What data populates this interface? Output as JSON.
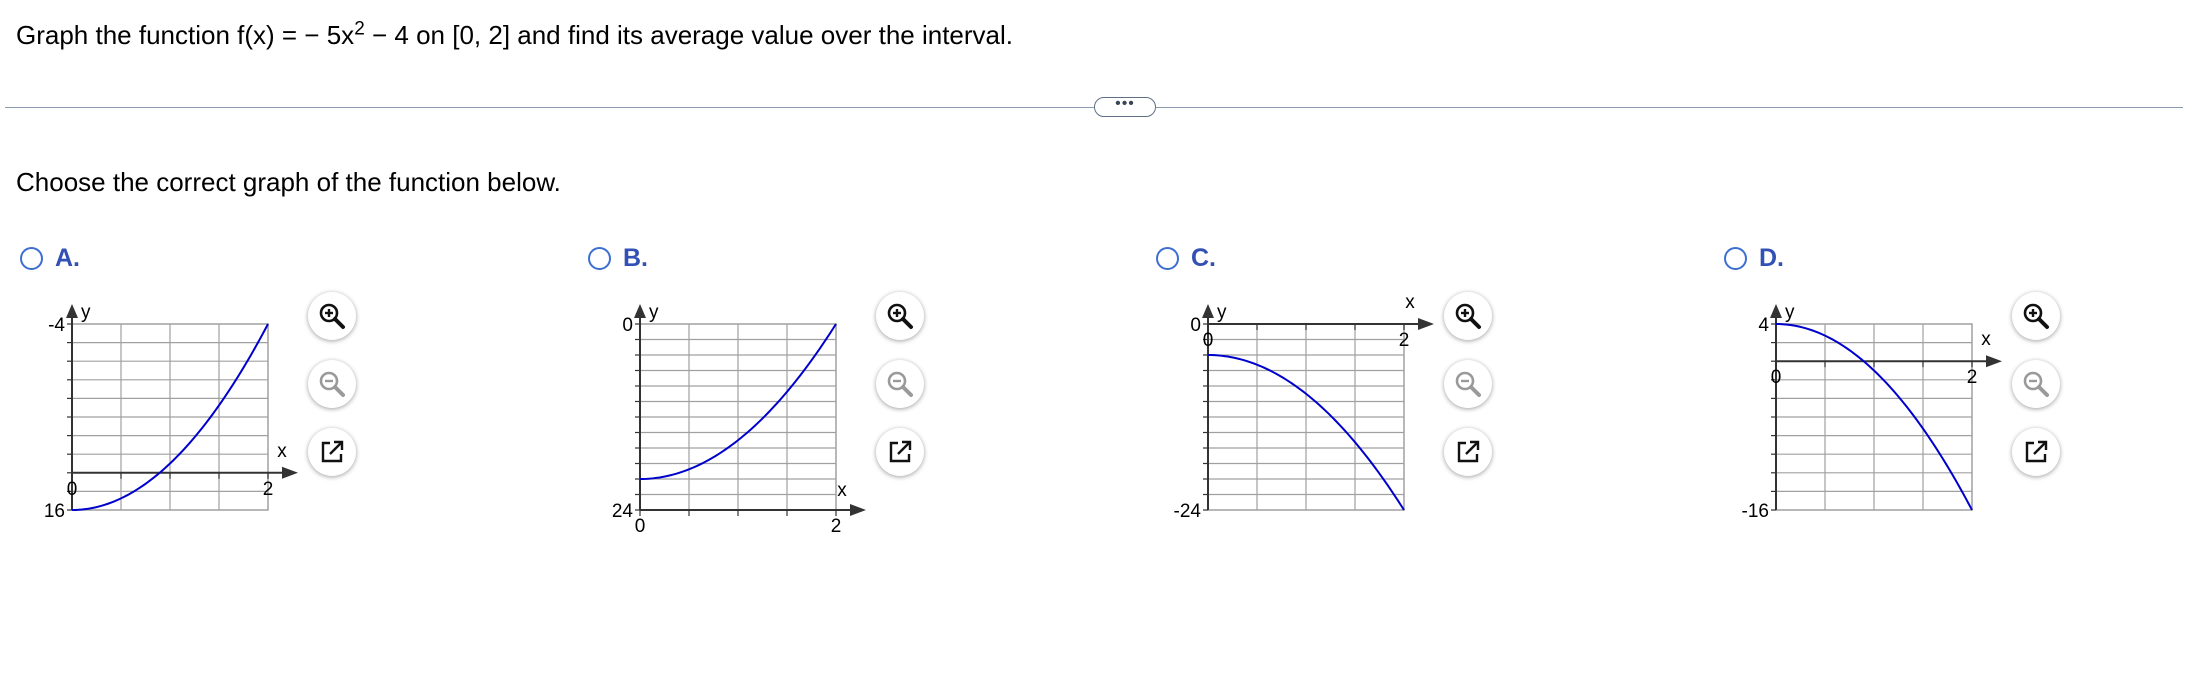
{
  "question": {
    "prefix": "Graph the function f(x) = − 5x",
    "exponent": "2",
    "suffix": " − 4 on [0, 2] and find its average value over the interval."
  },
  "more_button": {
    "label": "•••"
  },
  "instruction": "Choose the correct graph of the function below.",
  "options": [
    {
      "letter": "A.",
      "chart_data": {
        "type": "line",
        "xlabel": "x",
        "ylabel": "y",
        "xlim": [
          0,
          2
        ],
        "ylim": [
          -4,
          16
        ],
        "x_tick_labels": [
          "0",
          "2"
        ],
        "y_tick_labels": [
          "-4",
          "16"
        ],
        "series": [
          {
            "function": "5x^2 - 4",
            "x": [
              0,
              0.5,
              1,
              1.5,
              2
            ],
            "y": [
              -4,
              -2.75,
              1,
              7.25,
              16
            ]
          }
        ]
      }
    },
    {
      "letter": "B.",
      "chart_data": {
        "type": "line",
        "xlabel": "x",
        "ylabel": "y",
        "xlim": [
          0,
          2
        ],
        "ylim": [
          0,
          24
        ],
        "x_tick_labels": [
          "0",
          "2"
        ],
        "y_tick_labels": [
          "0",
          "24"
        ],
        "series": [
          {
            "function": "5x^2 + 4",
            "x": [
              0,
              0.5,
              1,
              1.5,
              2
            ],
            "y": [
              4,
              5.25,
              9,
              15.25,
              24
            ]
          }
        ]
      }
    },
    {
      "letter": "C.",
      "chart_data": {
        "type": "line",
        "xlabel": "x",
        "ylabel": "y",
        "xlim": [
          0,
          2
        ],
        "ylim": [
          -24,
          0
        ],
        "x_tick_labels": [
          "0",
          "2"
        ],
        "y_tick_labels": [
          "0",
          "-24"
        ],
        "series": [
          {
            "function": "-5x^2 - 4",
            "x": [
              0,
              0.5,
              1,
              1.5,
              2
            ],
            "y": [
              -4,
              -5.25,
              -9,
              -15.25,
              -24
            ]
          }
        ]
      }
    },
    {
      "letter": "D.",
      "chart_data": {
        "type": "line",
        "xlabel": "x",
        "ylabel": "y",
        "xlim": [
          0,
          2
        ],
        "ylim": [
          -16,
          4
        ],
        "x_tick_labels": [
          "0",
          "2"
        ],
        "y_tick_labels": [
          "4",
          "-16"
        ],
        "series": [
          {
            "function": "-5x^2 + 4",
            "x": [
              0,
              0.5,
              1,
              1.5,
              2
            ],
            "y": [
              4,
              2.75,
              -1,
              -7.25,
              -16
            ]
          }
        ]
      }
    }
  ],
  "tools": {
    "zoom_in_icon": "magnifier-plus-icon",
    "zoom_out_icon": "magnifier-minus-icon",
    "open_icon": "external-link-icon"
  },
  "colors": {
    "curve": "#0000cc",
    "radio": "#3d6fd1",
    "option_letter": "#3351b5",
    "grid": "#a0a0a0"
  }
}
